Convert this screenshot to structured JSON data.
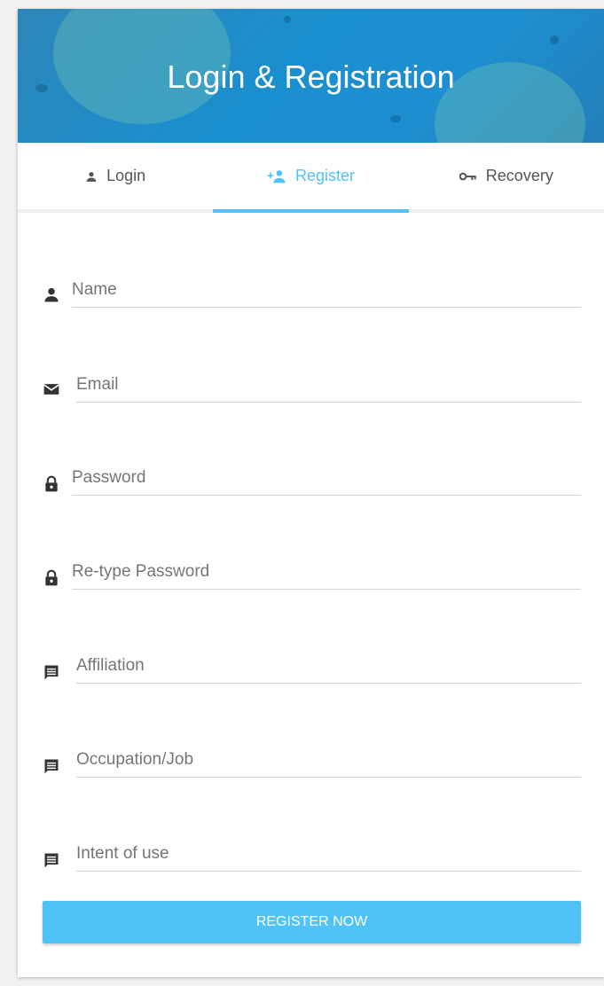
{
  "header": {
    "title": "Login & Registration"
  },
  "tabs": [
    {
      "label": "Login",
      "icon": "person-icon",
      "active": false
    },
    {
      "label": "Register",
      "icon": "person-add-icon",
      "active": true
    },
    {
      "label": "Recovery",
      "icon": "key-icon",
      "active": false
    }
  ],
  "form": {
    "fields": [
      {
        "placeholder": "Name",
        "value": "",
        "icon": "person-icon"
      },
      {
        "placeholder": "Email",
        "value": "",
        "icon": "email-icon"
      },
      {
        "placeholder": "Password",
        "value": "",
        "icon": "lock-icon"
      },
      {
        "placeholder": "Re-type Password",
        "value": "",
        "icon": "lock-icon"
      },
      {
        "placeholder": "Affiliation",
        "value": "",
        "icon": "message-icon"
      },
      {
        "placeholder": "Occupation/Job",
        "value": "",
        "icon": "message-icon"
      },
      {
        "placeholder": "Intent of use",
        "value": "",
        "icon": "message-icon"
      }
    ],
    "submit_label": "REGISTER NOW"
  },
  "colors": {
    "accent": "#4fc3f7",
    "header_bg": "#1d8fd0",
    "text_muted": "#757575",
    "icon": "#333333"
  }
}
